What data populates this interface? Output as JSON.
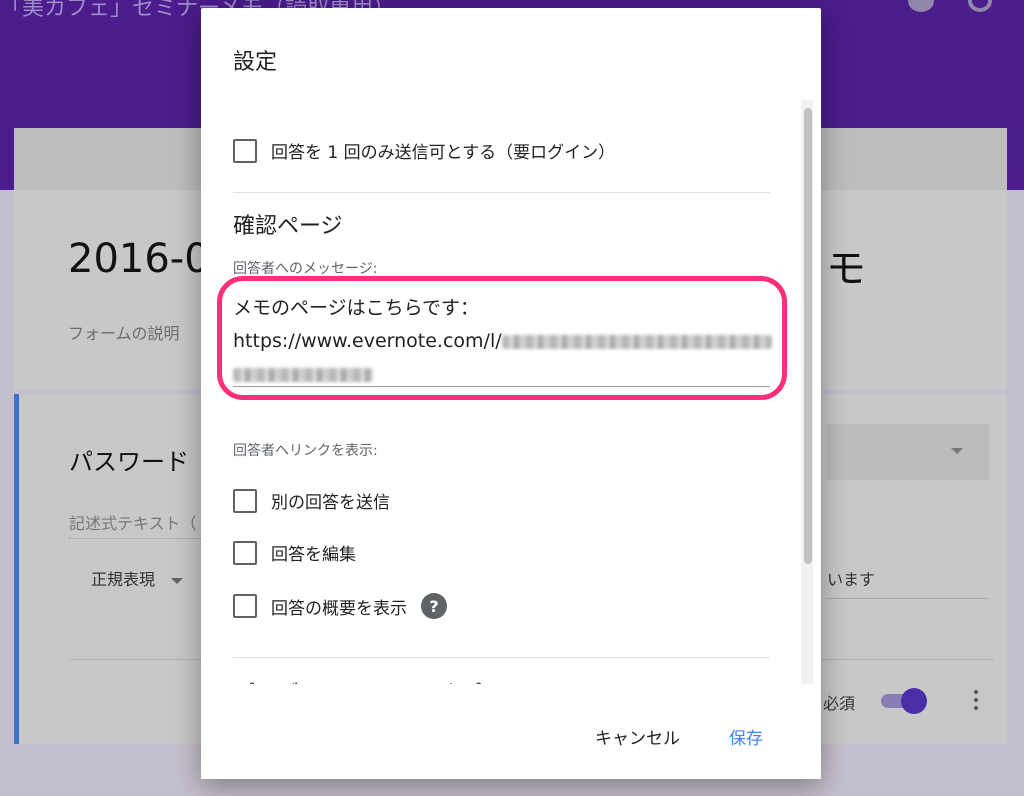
{
  "background": {
    "header_title": "「美カフェ」セミナーメモ（読取専用）",
    "form_title_left": "2016-0",
    "form_title_right": "モ",
    "form_description": "フォームの説明",
    "question_title": "パスワード",
    "question_hint": "記述式テキスト（",
    "validation_type": "正規表現",
    "validation_text": "います",
    "required_label": "必須"
  },
  "dialog": {
    "title": "設定",
    "limit_one_response_label": "回答を 1 回のみ送信可とする（要ログイン）",
    "confirmation_section_title": "確認ページ",
    "message_label": "回答者へのメッセージ:",
    "message_line1": "メモのページはこちらです：",
    "message_url_prefix": "https://www.evernote.com/l/",
    "show_links_label": "回答者へリンクを表示:",
    "options": [
      {
        "label": "別の回答を送信"
      },
      {
        "label": "回答を編集"
      },
      {
        "label": "回答の概要を表示"
      }
    ],
    "help_icon_glyph": "?",
    "presentation_section_title": "プレゼンテーション オプション",
    "cancel_label": "キャンセル",
    "save_label": "保存"
  },
  "colors": {
    "header_purple": "#4a1c8c",
    "highlight_pink": "#ff2e7a",
    "primary_blue": "#4285f4"
  }
}
